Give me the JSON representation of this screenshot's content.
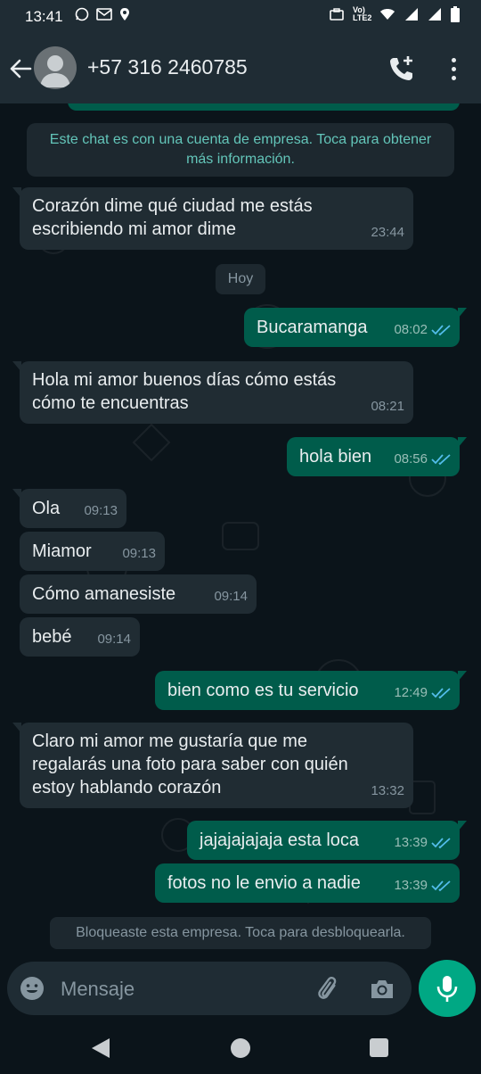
{
  "status_bar": {
    "time": "13:41",
    "network_label": "Vo) LTE2"
  },
  "header": {
    "contact_name": "+57 316 2460785"
  },
  "chat": {
    "previous_time": "",
    "business_banner": "Este chat es con una cuenta de empresa. Toca para obtener más información.",
    "date_chip": "Hoy",
    "messages": [
      {
        "direction": "in",
        "text": "Corazón dime qué ciudad me estás escribiendo mi amor dime",
        "time": "23:44"
      },
      {
        "direction": "out",
        "text": "Bucaramanga",
        "time": "08:02",
        "status": "read"
      },
      {
        "direction": "in",
        "text": "Hola mi amor buenos días cómo estás cómo te encuentras",
        "time": "08:21"
      },
      {
        "direction": "out",
        "text": "hola bien",
        "time": "08:56",
        "status": "read"
      },
      {
        "direction": "in",
        "text": "Ola",
        "time": "09:13"
      },
      {
        "direction": "in",
        "text": "Miamor",
        "time": "09:13"
      },
      {
        "direction": "in",
        "text": "Cómo amanesiste",
        "time": "09:14"
      },
      {
        "direction": "in",
        "text": "bebé",
        "time": "09:14"
      },
      {
        "direction": "out",
        "text": "bien como es tu servicio",
        "time": "12:49",
        "status": "read"
      },
      {
        "direction": "in",
        "text": "Claro mi amor me gustaría que me regalarás una foto para saber con quién estoy hablando corazón",
        "time": "13:32"
      },
      {
        "direction": "out",
        "text": "jajajajajaja esta loca",
        "time": "13:39",
        "status": "read"
      },
      {
        "direction": "out",
        "text": "fotos no le envio a nadie",
        "time": "13:39",
        "status": "read"
      }
    ],
    "blocked_banner": "Bloqueaste esta empresa. Toca para desbloquearla."
  },
  "composer": {
    "placeholder": "Mensaje"
  },
  "icons": {
    "status": [
      "whatsapp-icon",
      "mail-icon",
      "location-icon",
      "briefcase-icon",
      "wifi-icon",
      "signal-icon",
      "battery-icon"
    ],
    "header": [
      "back-arrow-icon",
      "avatar-icon",
      "add-call-icon",
      "more-vert-icon"
    ],
    "composer": [
      "emoji-icon",
      "attach-icon",
      "camera-icon",
      "mic-icon"
    ],
    "nav": [
      "nav-back-icon",
      "nav-home-icon",
      "nav-recent-icon"
    ]
  },
  "colors": {
    "outgoing_bubble": "#005c4b",
    "incoming_bubble": "#202c33",
    "header_bg": "#1f2c34",
    "chat_bg": "#0b141a",
    "accent": "#00a884",
    "read_ticks": "#53bdeb",
    "banner_text": "#63c5b9"
  }
}
